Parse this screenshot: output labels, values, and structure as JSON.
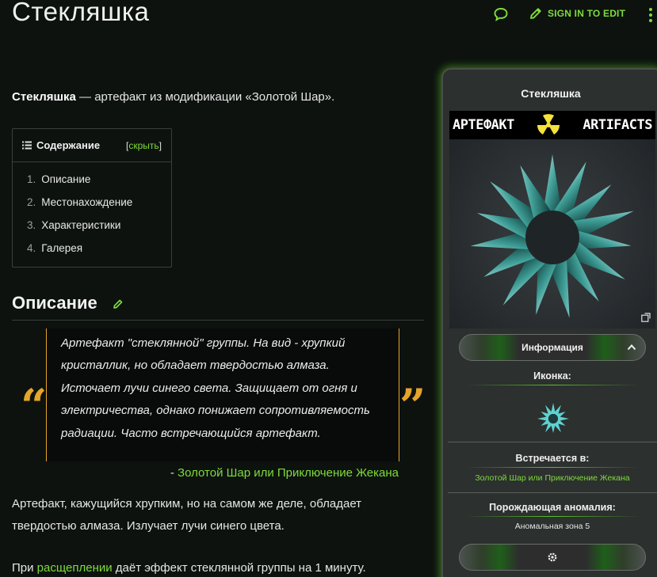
{
  "page": {
    "title": "Стекляшка"
  },
  "header": {
    "sign_in_label": "SIGN IN TO EDIT",
    "talk_icon": "speech-bubble-icon",
    "edit_icon": "pencil-icon",
    "more_icon": "kebab-icon"
  },
  "article": {
    "lead_bold": "Стекляшка",
    "lead_rest": " — артефакт из модификации «Золотой Шар».",
    "toc": {
      "title": "Содержание",
      "toggle_open": "[",
      "toggle_label": "скрыть",
      "toggle_close": "]",
      "items": [
        {
          "num": "1.",
          "label": "Описание"
        },
        {
          "num": "2.",
          "label": "Местонахождение"
        },
        {
          "num": "3.",
          "label": "Характеристики"
        },
        {
          "num": "4.",
          "label": "Галерея"
        }
      ]
    },
    "section_title": "Описание",
    "quote": {
      "open_mark": "“",
      "close_mark": "”",
      "text": "Артефакт \"стеклянной\" группы. На вид - хрупкий кристаллик, но обладает твердостью алмаза. Источает лучи синего света. Защищает от огня и электричества, однако понижает сопротивляемость радиации. Часто встречающийся артефакт.",
      "cite_prefix": "- ",
      "cite_link": "Золотой Шар или Приключение Жекана"
    },
    "para1": "Артефакт, кажущийся хрупким, но на самом же деле, обладает твердостью алмаза. Излучает лучи синего цвета.",
    "para2_before": "При ",
    "para2_link": "расщеплении",
    "para2_after": " даёт эффект стеклянной группы на 1 минуту."
  },
  "infobox": {
    "title": "Стекляшка",
    "banner_left": "АРТЕФАКТ",
    "banner_right": "ARTIFACTS",
    "info_bar_label": "Информация",
    "icon_label": "Иконка:",
    "found_label": "Встречается в:",
    "found_value": "Золотой Шар или Приключение Жекана",
    "anomaly_label": "Порождающая аномалия:",
    "anomaly_value": "Аномальная зона 5",
    "accent": "#7fdc3a",
    "glow": "#57c22a"
  }
}
